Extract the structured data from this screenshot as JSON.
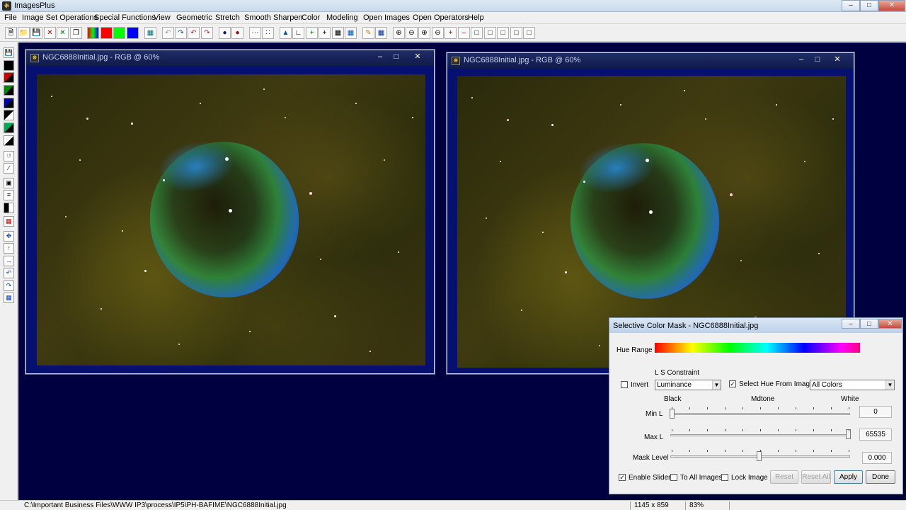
{
  "app": {
    "title": "ImagesPlus"
  },
  "menu": {
    "items": [
      "File",
      "Image Set Operations",
      "Special Functions",
      "View",
      "Geometric",
      "Stretch",
      "Smooth Sharpen",
      "Color",
      "Modeling",
      "Open Images",
      "Open Operators",
      "Help"
    ]
  },
  "windows": [
    {
      "caption": "NGC6888Initial.jpg - RGB @ 60%"
    },
    {
      "caption": "NGC6888Initial.jpg - RGB @ 60%"
    }
  ],
  "dialog": {
    "title": "Selective Color Mask - NGC6888Initial.jpg",
    "hue_range_label": "Hue Range",
    "ls_constraint_label": "L S Constraint",
    "invert_label": "Invert",
    "invert_checked": false,
    "luminance_value": "Luminance",
    "select_hue_label": "Select Hue From Image",
    "select_hue_checked": true,
    "colors_value": "All Colors",
    "black_label": "Black",
    "midtone_label": "Mdtone",
    "white_label": "White",
    "min_l_label": "Min L",
    "min_l_value": "0",
    "max_l_label": "Max L",
    "max_l_value": "65535",
    "mask_level_label": "Mask Level",
    "mask_level_value": "0.000",
    "enable_sliders_label": "Enable Sliders",
    "enable_sliders_checked": true,
    "to_all_images_label": "To All Images",
    "to_all_images_checked": false,
    "lock_image_label": "Lock Image",
    "lock_image_checked": false,
    "reset_label": "Reset",
    "reset_all_label": "Reset All",
    "apply_label": "Apply",
    "done_label": "Done"
  },
  "status": {
    "path": "C:\\Important Business Files\\WWW IP3\\process\\IP5\\PH-BAFIME\\NGC6888Initial.jpg",
    "dimensions": "1145 x 859",
    "zoom": "83%"
  },
  "colors": {
    "workspace": "#000040",
    "image_frame": "#061070"
  }
}
